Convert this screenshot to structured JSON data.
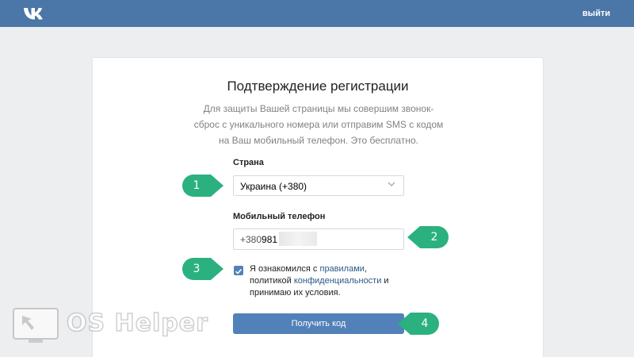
{
  "header": {
    "logo_icon": "vk-logo-icon",
    "logout_label": "выйти"
  },
  "form": {
    "title": "Подтверждение регистрации",
    "description": "Для защиты Вашей страницы мы совершим звонок-сброс с уникального номера или отправим SMS с кодом на Ваш мобильный телефон. Это бесплатно.",
    "country_label": "Страна",
    "country_value": "Украина (+380)",
    "phone_label": "Мобильный телефон",
    "phone_prefix": "+380",
    "phone_value": "981",
    "agree_checked": true,
    "agree_text_1": "Я ознакомился с ",
    "agree_link_rules": "правилами",
    "agree_text_2": ", политикой ",
    "agree_link_privacy": "конфиденциальности",
    "agree_text_3": " и принимаю их условия.",
    "submit_label": "Получить код"
  },
  "annotations": {
    "badge_color": "#2bb17f",
    "badges": [
      "1",
      "2",
      "3",
      "4"
    ]
  },
  "watermark": {
    "text": "OS Helper"
  },
  "colors": {
    "header_bg": "#4a76a8",
    "page_bg": "#edeef0",
    "button_bg": "#5181b8",
    "link": "#2a5885"
  }
}
